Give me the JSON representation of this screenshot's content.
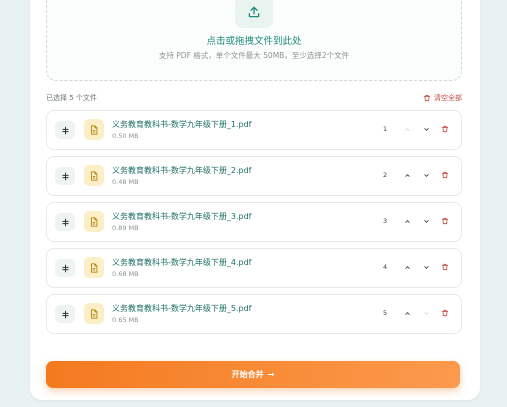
{
  "dropzone": {
    "title": "点击或拖拽文件到此处",
    "subtitle": "支持 PDF 格式，单个文件最大 50MB，至少选择2个文件"
  },
  "selection": {
    "label": "已选择 5 个文件",
    "clear_all": "清空全部"
  },
  "files": [
    {
      "name": "义务教育教科书-数学九年级下册_1.pdf",
      "size": "0.50 MB",
      "index": "1"
    },
    {
      "name": "义务教育教科书-数学九年级下册_2.pdf",
      "size": "0.48 MB",
      "index": "2"
    },
    {
      "name": "义务教育教科书-数学九年级下册_3.pdf",
      "size": "0.89 MB",
      "index": "3"
    },
    {
      "name": "义务教育教科书-数学九年级下册_4.pdf",
      "size": "0.68 MB",
      "index": "4"
    },
    {
      "name": "义务教育教科书-数学九年级下册_5.pdf",
      "size": "0.65 MB",
      "index": "5"
    }
  ],
  "merge_button": {
    "label": "开始合并",
    "arrow": "→"
  },
  "colors": {
    "accent": "#1d8a7c",
    "danger": "#c24b3b",
    "primary_button": "#f47a1f",
    "pdf_icon_bg": "#fcefc7"
  },
  "icons": {
    "upload": "upload-icon",
    "drag": "drag-handle-icon",
    "pdf": "pdf-file-icon",
    "up": "chevron-up-icon",
    "down": "chevron-down-icon",
    "delete": "trash-icon"
  }
}
